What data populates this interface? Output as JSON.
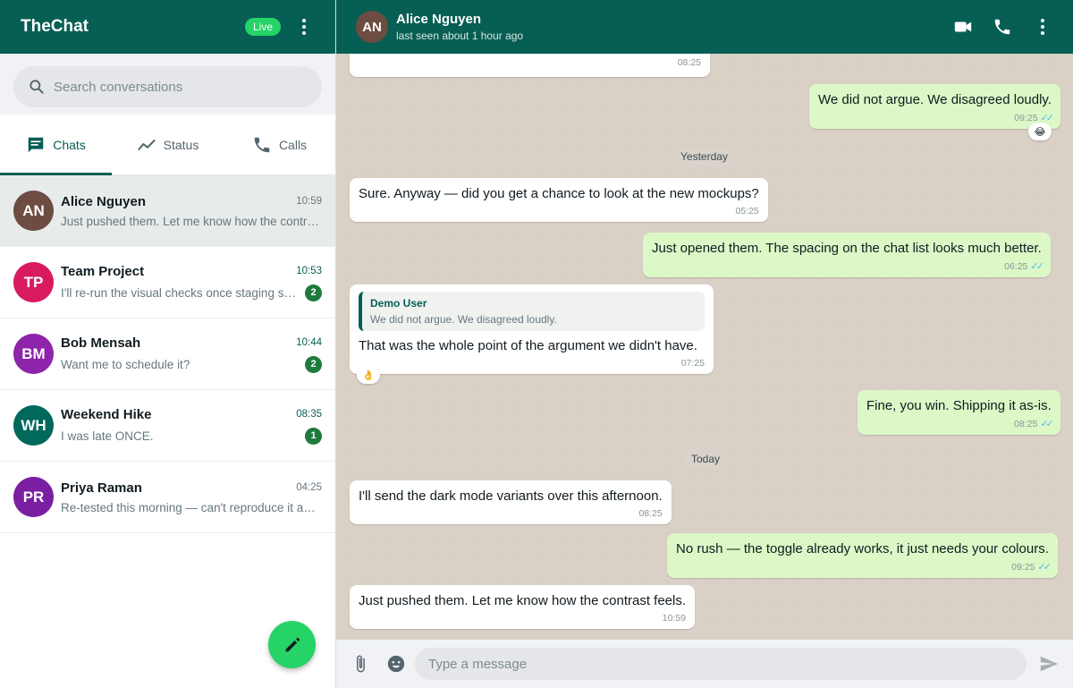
{
  "app": {
    "title": "TheChat",
    "live_label": "Live"
  },
  "search": {
    "placeholder": "Search conversations"
  },
  "tabs": [
    {
      "label": "Chats",
      "icon": "chat-icon",
      "active": true
    },
    {
      "label": "Status",
      "icon": "trending-icon",
      "active": false
    },
    {
      "label": "Calls",
      "icon": "phone-icon",
      "active": false
    }
  ],
  "chats": [
    {
      "initials": "AN",
      "name": "Alice Nguyen",
      "time": "10:59",
      "preview": "Just pushed them. Let me know how the contrast feels.",
      "unread": null,
      "color": "#6d4c41",
      "selected": true
    },
    {
      "initials": "TP",
      "name": "Team Project",
      "time": "10:53",
      "preview": "I'll re-run the visual checks once staging settles.",
      "unread": "2",
      "color": "#d81b60",
      "selected": false
    },
    {
      "initials": "BM",
      "name": "Bob Mensah",
      "time": "10:44",
      "preview": "Want me to schedule it?",
      "unread": "2",
      "color": "#8e24aa",
      "selected": false
    },
    {
      "initials": "WH",
      "name": "Weekend Hike",
      "time": "08:35",
      "preview": "I was late ONCE.",
      "unread": "1",
      "color": "#00695c",
      "selected": false
    },
    {
      "initials": "PR",
      "name": "Priya Raman",
      "time": "04:25",
      "preview": "Re-tested this morning — can't reproduce it any more.",
      "unread": null,
      "color": "#7b1fa2",
      "selected": false
    }
  ],
  "conversation": {
    "initials": "AN",
    "name": "Alice Nguyen",
    "status": "last seen about 1 hour ago"
  },
  "messages": [
    {
      "id": "m0",
      "dir": "in",
      "text": "",
      "time": "08:25"
    },
    {
      "id": "m1",
      "dir": "out",
      "text": "We did not argue. We disagreed loudly.",
      "time": "09:25",
      "reaction": "😂"
    },
    {
      "id": "d1",
      "date": "Yesterday"
    },
    {
      "id": "m2",
      "dir": "in",
      "text": "Sure. Anyway — did you get a chance to look at the new mockups?",
      "time": "05:25"
    },
    {
      "id": "m3",
      "dir": "out",
      "text": "Just opened them. The spacing on the chat list looks much better.",
      "time": "06:25"
    },
    {
      "id": "m4",
      "dir": "in",
      "text": "That was the whole point of the argument we didn't have.",
      "time": "07:25",
      "quote_author": "Demo User",
      "quote_text": "We did not argue. We disagreed loudly.",
      "reaction": "👌"
    },
    {
      "id": "m5",
      "dir": "out",
      "text": "Fine, you win. Shipping it as-is.",
      "time": "08:25"
    },
    {
      "id": "d2",
      "date": "Today"
    },
    {
      "id": "m6",
      "dir": "in",
      "text": "I'll send the dark mode variants over this afternoon.",
      "time": "08:25"
    },
    {
      "id": "m7",
      "dir": "out",
      "text": "No rush — the toggle already works, it just needs your colours.",
      "time": "09:25"
    },
    {
      "id": "m8",
      "dir": "in",
      "text": "Just pushed them. Let me know how the contrast feels.",
      "time": "10:59"
    }
  ],
  "composer": {
    "placeholder": "Type a message"
  },
  "colors": {
    "primary": "#075e54",
    "accent": "#25d366",
    "outgoing": "#dcf8c6",
    "unread_badge": "#1f7a3e",
    "read_ticks": "#53bdeb"
  }
}
